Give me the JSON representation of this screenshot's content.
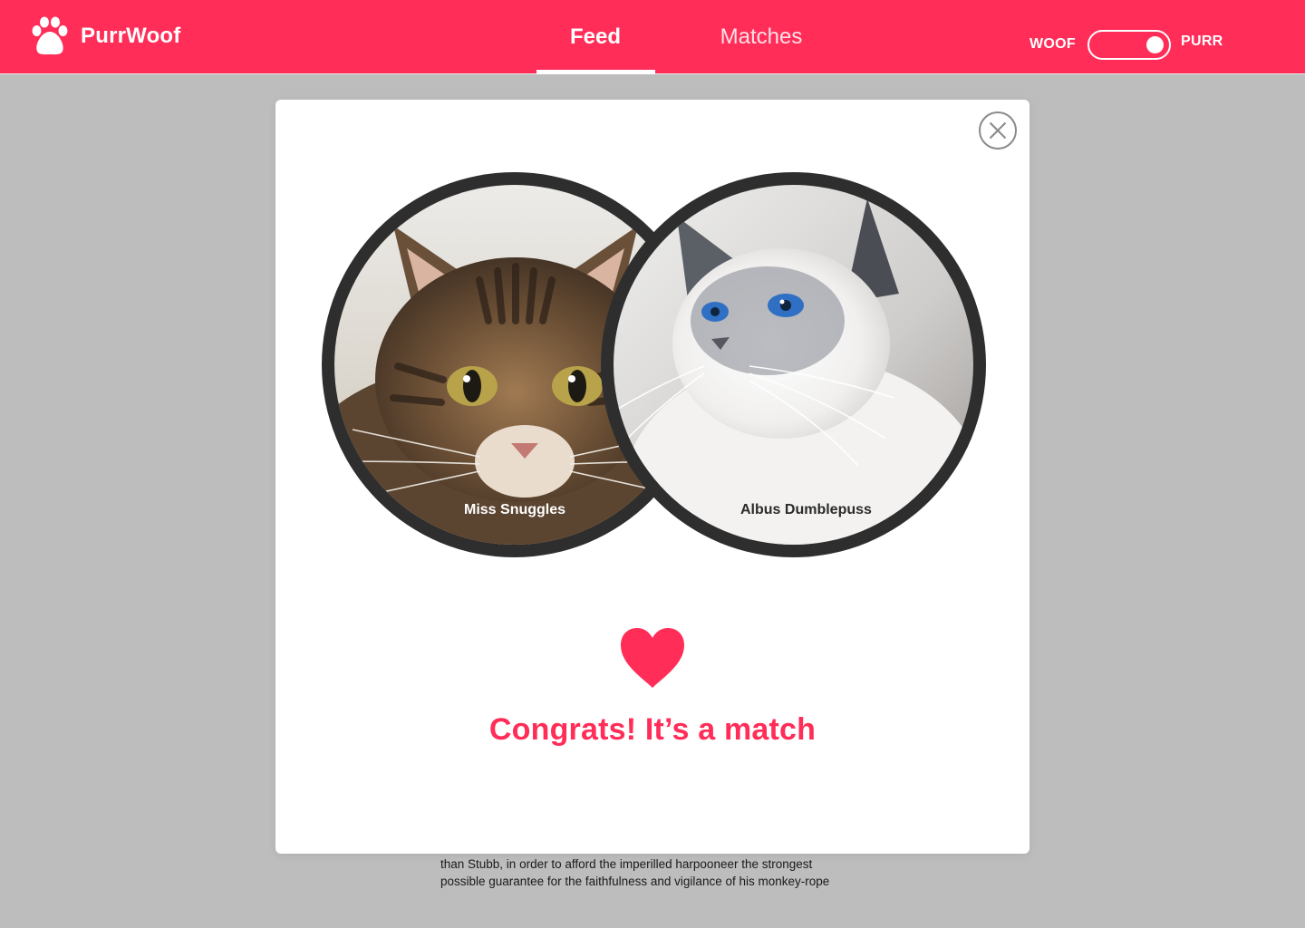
{
  "app": {
    "name": "PurrWoof",
    "logo_icon": "paw-icon"
  },
  "nav": {
    "tabs": [
      {
        "label": "Feed",
        "active": true
      },
      {
        "label": "Matches",
        "active": false
      }
    ]
  },
  "species_toggle": {
    "left_label": "WOOF",
    "right_label": "PURR",
    "selected": "PURR"
  },
  "background_text": {
    "lines": [
      "than Stubb, in order to afford the imperilled harpooneer the strongest",
      "possible guarantee for the faithfulness and vigilance of his monkey-rope"
    ]
  },
  "match_modal": {
    "close_icon": "close-icon",
    "pets": [
      {
        "name": "Miss Snuggles",
        "photo": "tabby-cat-photo"
      },
      {
        "name": "Albus Dumblepuss",
        "photo": "white-cat-photo"
      }
    ],
    "heart_icon": "heart-icon",
    "message": "Congrats! It’s a match"
  },
  "colors": {
    "brand": "#ff2d58",
    "overlay": "#bdbdbd",
    "avatar_ring": "#2e2e2e"
  }
}
